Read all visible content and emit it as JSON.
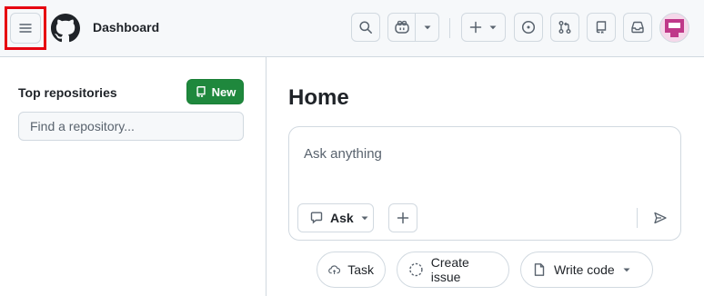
{
  "header": {
    "context_title": "Dashboard",
    "icons": {
      "menu": "hamburger-menu-icon",
      "logo": "github-mark-icon",
      "search": "search-icon",
      "copilot": "copilot-icon",
      "create": "plus-icon",
      "issues": "issue-opened-icon",
      "pulls": "git-pull-request-icon",
      "repos": "repo-icon",
      "inbox": "inbox-icon",
      "avatar": "avatar-identicon"
    }
  },
  "sidebar": {
    "title": "Top repositories",
    "new_button_label": "New",
    "search_placeholder": "Find a repository..."
  },
  "main": {
    "title": "Home",
    "ask_box": {
      "placeholder": "Ask anything",
      "mode_label": "Ask"
    },
    "quick_actions": [
      {
        "label": "Task",
        "icon": "cloud-agent-icon"
      },
      {
        "label": "Create issue",
        "icon": "issue-dashed-circle-icon"
      },
      {
        "label": "Write code",
        "icon": "file-icon"
      }
    ]
  },
  "colors": {
    "highlight": "#e6000f",
    "new_button": "#1f883d",
    "avatar": "#bf3989",
    "header_bg": "#f6f8fa",
    "border": "#d1d9e0"
  }
}
